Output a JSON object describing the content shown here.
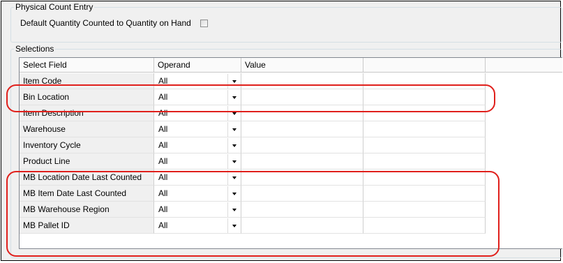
{
  "physical_count": {
    "legend": "Physical Count Entry",
    "default_label": "Default Quantity Counted to Quantity on Hand",
    "default_checked": false
  },
  "selections": {
    "legend": "Selections",
    "headers": [
      "Select Field",
      "Operand",
      "Value",
      ""
    ],
    "rows": [
      {
        "field": "Item Code",
        "operand": "All",
        "value": ""
      },
      {
        "field": "Bin Location",
        "operand": "All",
        "value": ""
      },
      {
        "field": "Item Description",
        "operand": "All",
        "value": ""
      },
      {
        "field": "Warehouse",
        "operand": "All",
        "value": ""
      },
      {
        "field": "Inventory Cycle",
        "operand": "All",
        "value": ""
      },
      {
        "field": "Product Line",
        "operand": "All",
        "value": ""
      },
      {
        "field": "MB Location Date Last Counted",
        "operand": "All",
        "value": ""
      },
      {
        "field": "MB Item Date Last Counted",
        "operand": "All",
        "value": ""
      },
      {
        "field": "MB Warehouse Region",
        "operand": "All",
        "value": ""
      },
      {
        "field": "MB Pallet ID",
        "operand": "All",
        "value": ""
      }
    ]
  },
  "highlight_color": "#e0201c"
}
